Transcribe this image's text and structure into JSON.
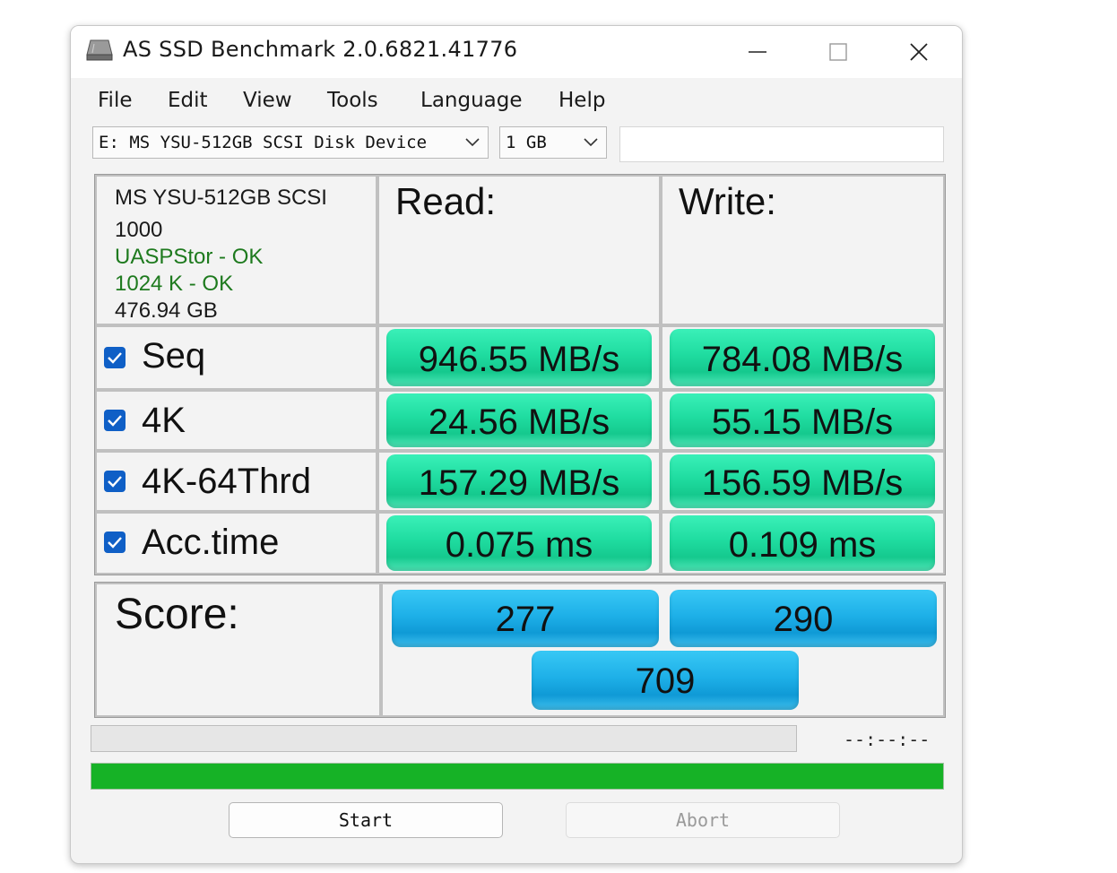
{
  "window": {
    "title": "AS SSD Benchmark 2.0.6821.41776"
  },
  "menu": [
    "File",
    "Edit",
    "View",
    "Tools",
    "Language",
    "Help"
  ],
  "drive_select": {
    "value": "E: MS YSU-512GB SCSI Disk Device"
  },
  "size_select": {
    "value": "1 GB"
  },
  "device_info": {
    "name": "MS YSU-512GB SCSI",
    "firmware": "1000",
    "driver_status": "UASPStor - OK",
    "alignment_status": "1024 K - OK",
    "capacity": "476.94 GB"
  },
  "columns": {
    "read": "Read:",
    "write": "Write:"
  },
  "tests": [
    {
      "label": "Seq",
      "checked": true,
      "read": "946.55 MB/s",
      "write": "784.08 MB/s"
    },
    {
      "label": "4K",
      "checked": true,
      "read": "24.56 MB/s",
      "write": "55.15 MB/s"
    },
    {
      "label": "4K-64Thrd",
      "checked": true,
      "read": "157.29 MB/s",
      "write": "156.59 MB/s"
    },
    {
      "label": "Acc.time",
      "checked": true,
      "read": "0.075 ms",
      "write": "0.109 ms"
    }
  ],
  "score": {
    "label": "Score:",
    "read": "277",
    "write": "290",
    "total": "709"
  },
  "progress": {
    "elapsed": "--:--:--",
    "test_progress": 0,
    "overall_progress": 1.0
  },
  "buttons": {
    "start": "Start",
    "abort": "Abort"
  },
  "colors": {
    "result_green": "#1fdca0",
    "score_blue": "#1eb0e8",
    "progress_green": "#16b226",
    "ok_text": "#1e7a1e",
    "checkbox_blue": "#0f5fc6"
  }
}
